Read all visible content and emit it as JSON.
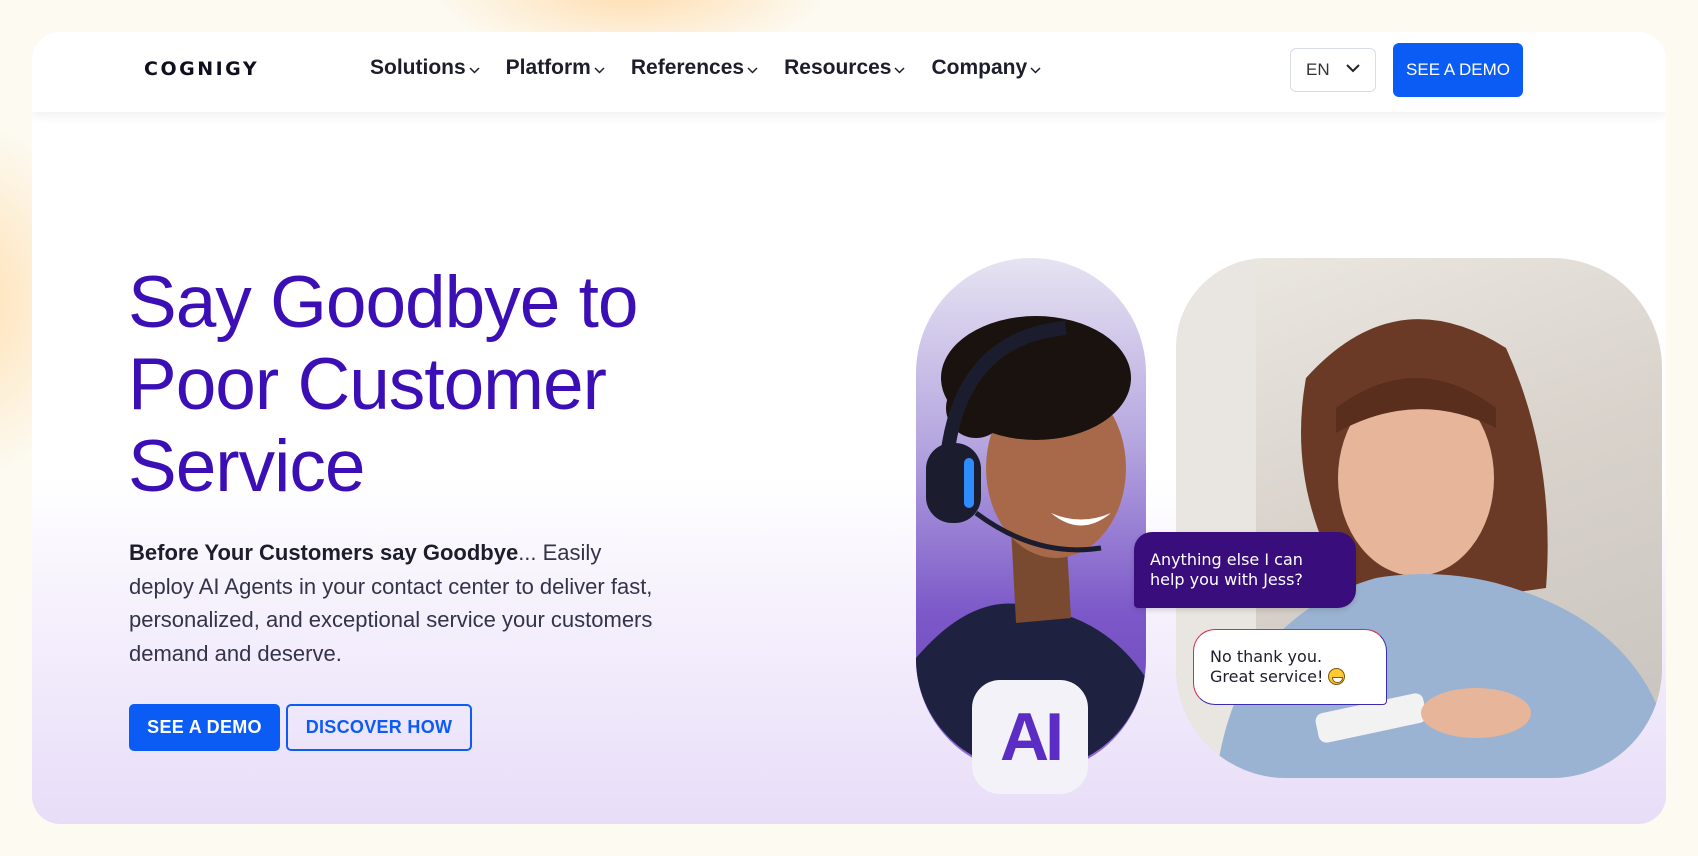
{
  "brand": {
    "logo_text": "COGNIGY"
  },
  "nav": {
    "items": [
      {
        "label": "Solutions"
      },
      {
        "label": "Platform"
      },
      {
        "label": "References"
      },
      {
        "label": "Resources"
      },
      {
        "label": "Company"
      }
    ],
    "language": "EN",
    "cta_label": "SEE A DEMO"
  },
  "hero": {
    "headline_line1": "Say Goodbye to",
    "headline_line2": "Poor Customer",
    "headline_line3": "Service",
    "sub_bold": "Before Your Customers say Goodbye",
    "sub_rest": "... Easily deploy AI Agents in your contact center to deliver fast, personalized, and exceptional service your customers demand and deserve.",
    "primary_button": "SEE A DEMO",
    "secondary_button": "DISCOVER HOW"
  },
  "visual": {
    "ai_badge": "AI",
    "ai_message_line1": "Anything else I can",
    "ai_message_line2": "help you with Jess?",
    "user_message_line1": "No thank you.",
    "user_message_line2": "Great service!"
  },
  "colors": {
    "accent": "#0b5cf5",
    "headline": "#3b0fb5",
    "ai_bubble": "#3a0d7d"
  }
}
